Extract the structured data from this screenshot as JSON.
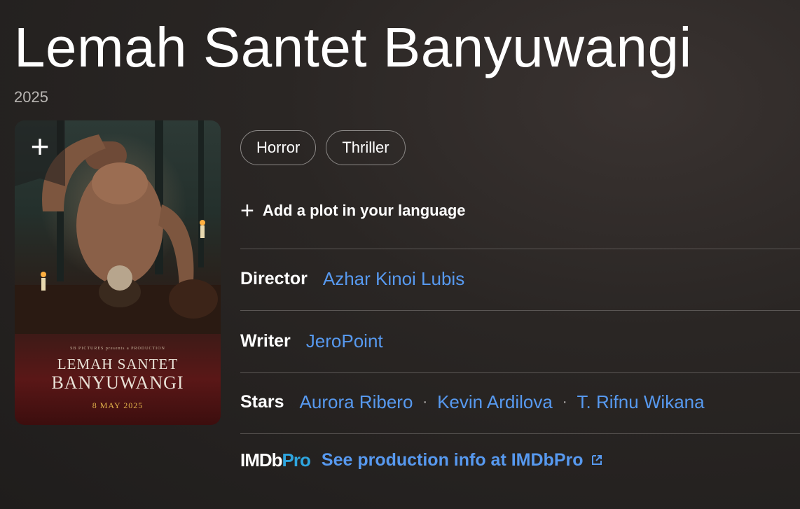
{
  "title": "Lemah Santet Banyuwangi",
  "year": "2025",
  "poster": {
    "add_icon": "plus-icon",
    "tagline": "SB PICTURES presents a PRODUCTION",
    "title_line1": "LEMAH SANTET",
    "title_line2": "BANYUWANGI",
    "release": "8 MAY 2025"
  },
  "genres": [
    "Horror",
    "Thriller"
  ],
  "plot": {
    "icon": "plus-icon",
    "label": "Add a plot in your language"
  },
  "director": {
    "label": "Director",
    "name": "Azhar Kinoi Lubis"
  },
  "writer": {
    "label": "Writer",
    "name": "JeroPoint"
  },
  "stars": {
    "label": "Stars",
    "names": [
      "Aurora Ribero",
      "Kevin Ardilova",
      "T. Rifnu Wikana"
    ],
    "separator": "·"
  },
  "imdbpro": {
    "logo_a": "IMDb",
    "logo_b": "Pro",
    "link": "See production info at IMDbPro",
    "icon": "external-link-icon"
  },
  "colors": {
    "link": "#5799ef",
    "pro_accent": "#2ea5df",
    "background": "#2a2624"
  }
}
